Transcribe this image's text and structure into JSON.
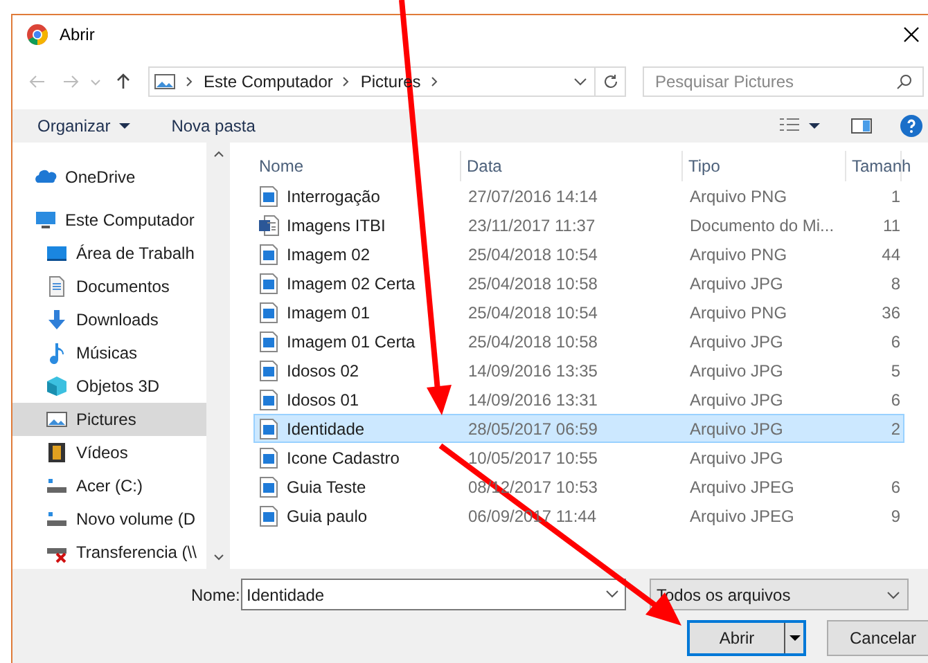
{
  "window": {
    "title": "Abrir"
  },
  "address": {
    "path": [
      "Este Computador",
      "Pictures"
    ]
  },
  "search": {
    "placeholder": "Pesquisar Pictures"
  },
  "toolbar": {
    "buttons": [
      "Organizar",
      "Nova pasta"
    ]
  },
  "sidebar": {
    "items": [
      {
        "label": "OneDrive",
        "kind": "cloud",
        "selected": false
      },
      {
        "label": "Este Computador",
        "kind": "computer",
        "selected": false,
        "children": [
          {
            "label": "Área de Trabalh",
            "kind": "desktop",
            "selected": false
          },
          {
            "label": "Documentos",
            "kind": "documents",
            "selected": false
          },
          {
            "label": "Downloads",
            "kind": "downloads",
            "selected": false
          },
          {
            "label": "Músicas",
            "kind": "music",
            "selected": false
          },
          {
            "label": "Objetos 3D",
            "kind": "objects",
            "selected": false
          },
          {
            "label": "Pictures",
            "kind": "pictures",
            "selected": true
          },
          {
            "label": "Vídeos",
            "kind": "videos",
            "selected": false
          },
          {
            "label": "Acer (C:)",
            "kind": "drive",
            "selected": false
          },
          {
            "label": "Novo volume (D",
            "kind": "drive",
            "selected": false
          },
          {
            "label": "Transferencia (\\\\",
            "kind": "network",
            "selected": false
          }
        ]
      }
    ]
  },
  "table": {
    "columns": [
      "Nome",
      "Data",
      "Tipo",
      "Tamanh"
    ],
    "rows": [
      {
        "name": "Interrogação",
        "date": "27/07/2016 14:14",
        "type": "Arquivo PNG",
        "size": "1",
        "kind": "image",
        "selected": false
      },
      {
        "name": "Imagens ITBI",
        "date": "23/11/2017 11:37",
        "type": "Documento do Mi...",
        "size": "11",
        "kind": "document",
        "selected": false
      },
      {
        "name": "Imagem 02",
        "date": "25/04/2018 10:54",
        "type": "Arquivo PNG",
        "size": "44",
        "kind": "image",
        "selected": false
      },
      {
        "name": "Imagem 02 Certa",
        "date": "25/04/2018 10:58",
        "type": "Arquivo JPG",
        "size": "8",
        "kind": "image",
        "selected": false
      },
      {
        "name": "Imagem 01",
        "date": "25/04/2018 10:54",
        "type": "Arquivo PNG",
        "size": "36",
        "kind": "image",
        "selected": false
      },
      {
        "name": "Imagem 01 Certa",
        "date": "25/04/2018 10:58",
        "type": "Arquivo JPG",
        "size": "6",
        "kind": "image",
        "selected": false
      },
      {
        "name": "Idosos 02",
        "date": "14/09/2016 13:35",
        "type": "Arquivo JPG",
        "size": "5",
        "kind": "image",
        "selected": false
      },
      {
        "name": "Idosos 01",
        "date": "14/09/2016 13:31",
        "type": "Arquivo JPG",
        "size": "6",
        "kind": "image",
        "selected": false
      },
      {
        "name": "Identidade",
        "date": "28/05/2017 06:59",
        "type": "Arquivo JPG",
        "size": "2",
        "kind": "image",
        "selected": true
      },
      {
        "name": "Icone Cadastro",
        "date": "10/05/2017 10:55",
        "type": "Arquivo JPG",
        "kind": "image",
        "selected": false
      },
      {
        "name": "Guia Teste",
        "date": "08/12/2017 10:53",
        "type": "Arquivo JPEG",
        "size": "6",
        "kind": "image",
        "selected": false
      },
      {
        "name": "Guia paulo",
        "date": "06/09/2017 11:44",
        "type": "Arquivo JPEG",
        "size": "9",
        "kind": "image",
        "selected": false
      }
    ]
  },
  "footer": {
    "name_label": "Nome:",
    "name_value": "Identidade",
    "filter": "Todos os arquivos",
    "buttons": [
      "Abrir",
      "Cancelar"
    ]
  }
}
